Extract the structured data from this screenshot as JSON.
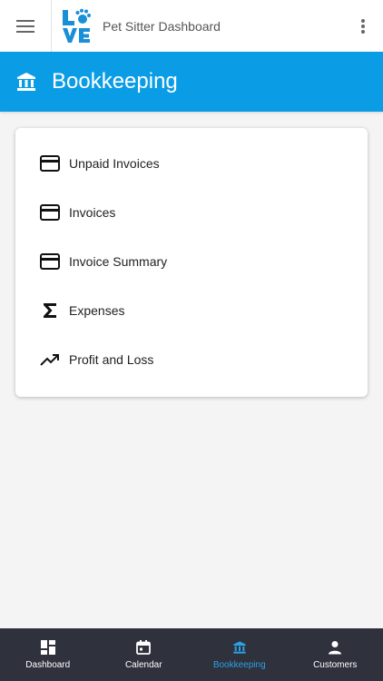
{
  "app": {
    "title": "Pet Sitter Dashboard",
    "logo_text": "LOVE"
  },
  "header": {
    "title": "Bookkeeping",
    "icon": "bank-icon",
    "color": "#0a9de6"
  },
  "menu": {
    "items": [
      {
        "label": "Unpaid Invoices",
        "icon": "credit-card-icon"
      },
      {
        "label": "Invoices",
        "icon": "credit-card-icon"
      },
      {
        "label": "Invoice Summary",
        "icon": "credit-card-icon"
      },
      {
        "label": "Expenses",
        "icon": "sigma-icon"
      },
      {
        "label": "Profit and Loss",
        "icon": "trending-up-icon"
      }
    ]
  },
  "bottom_nav": {
    "items": [
      {
        "label": "Dashboard",
        "icon": "dashboard-icon",
        "active": false
      },
      {
        "label": "Calendar",
        "icon": "calendar-icon",
        "active": false
      },
      {
        "label": "Bookkeeping",
        "icon": "bank-icon",
        "active": true
      },
      {
        "label": "Customers",
        "icon": "person-icon",
        "active": false
      }
    ],
    "background": "#2f313d",
    "active_color": "#2aa3e6"
  }
}
